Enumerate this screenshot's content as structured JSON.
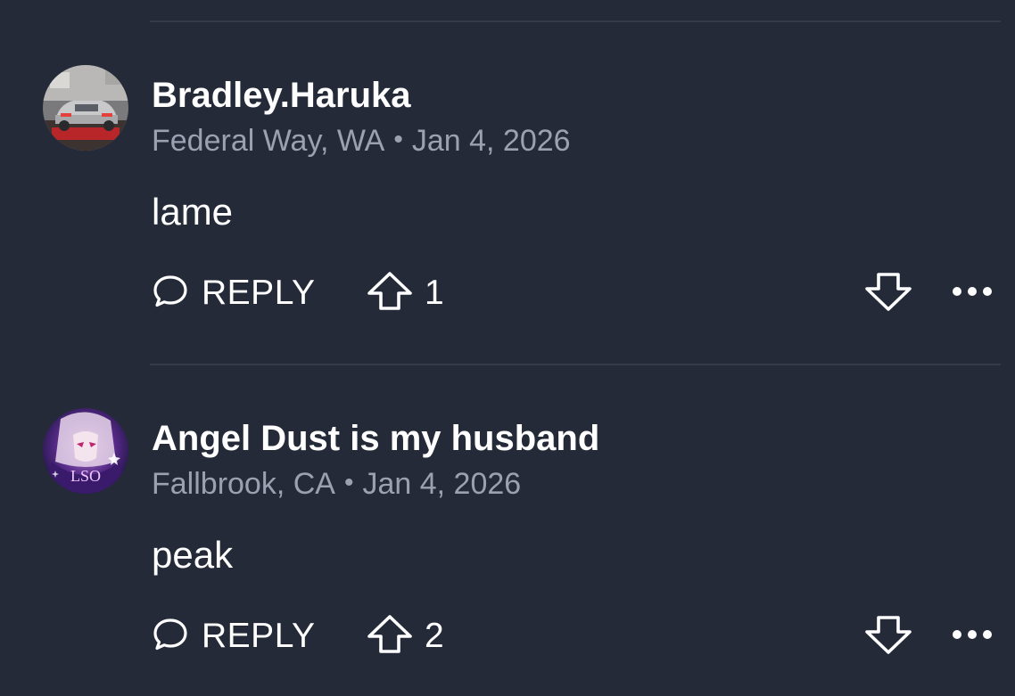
{
  "comments": [
    {
      "username": "Bradley.Haruka",
      "location": "Federal Way, WA",
      "separator": "•",
      "date": "Jan 4, 2026",
      "text": "lame",
      "reply_label": "REPLY",
      "upvotes": "1",
      "avatar": "car-photo-avatar"
    },
    {
      "username": "Angel Dust is my husband",
      "location": "Fallbrook, CA",
      "separator": "•",
      "date": "Jan 4, 2026",
      "text": "peak",
      "reply_label": "REPLY",
      "upvotes": "2",
      "avatar": "anime-character-avatar",
      "avatar_text": "LSO"
    }
  ],
  "icons": {
    "reply": "speech-bubble-icon",
    "upvote": "arrow-up-icon",
    "downvote": "arrow-down-icon",
    "more": "ellipsis-icon"
  },
  "colors": {
    "background": "#242a38",
    "divider": "#343b4a",
    "text_primary": "#ffffff",
    "text_secondary": "#9aa1b0"
  }
}
